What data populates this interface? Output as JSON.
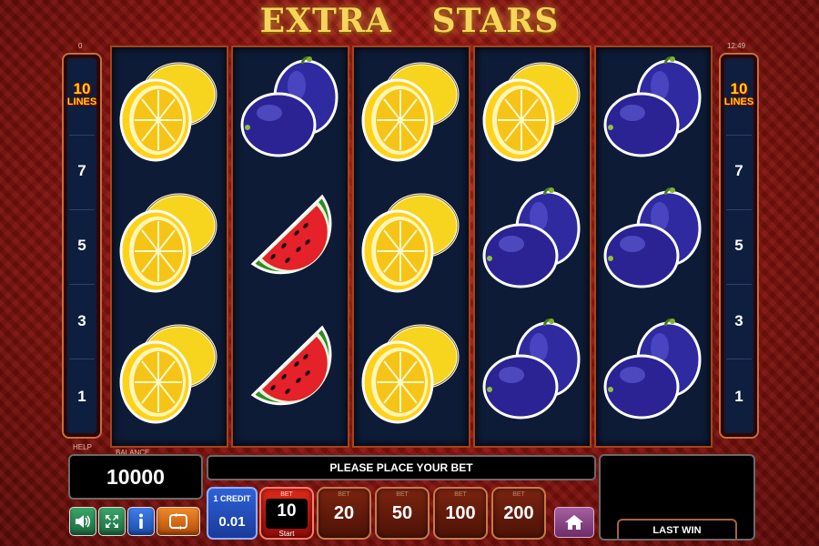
{
  "game": {
    "title_part1": "EXTRA",
    "title_part2": "STARS"
  },
  "corners": {
    "left_top": "0",
    "right_top": "12:49"
  },
  "lines_panel": {
    "count": "10",
    "label": "LINES",
    "numbers": [
      "7",
      "5",
      "3",
      "1"
    ]
  },
  "reels": [
    [
      "lemon",
      "lemon",
      "lemon"
    ],
    [
      "plum",
      "watermelon",
      "watermelon"
    ],
    [
      "lemon",
      "lemon",
      "lemon"
    ],
    [
      "lemon",
      "plum",
      "plum"
    ],
    [
      "plum",
      "plum",
      "plum"
    ]
  ],
  "labels": {
    "help": "HELP",
    "balance": "BALANCE",
    "bet": "BET",
    "bet_caption": "BET"
  },
  "balance": {
    "value": "10000"
  },
  "message": "PLEASE PLACE YOUR BET",
  "last_win": {
    "label": "LAST WIN",
    "value": ""
  },
  "controls": {
    "sound_icon": "speaker-icon",
    "fullscreen_icon": "fullscreen-icon",
    "info_icon": "info-icon",
    "autoplay_icon": "autoplay-icon",
    "home_icon": "home-icon"
  },
  "credit": {
    "label": "1 CREDIT",
    "value": "0.01"
  },
  "bet": {
    "current": "10",
    "start_label": "Start"
  },
  "bet_options": [
    "20",
    "50",
    "100",
    "200"
  ],
  "colors": {
    "lines_title": "#ffd200",
    "active_bet": "#e02a1c",
    "credit_btn": "#2e62d8"
  }
}
